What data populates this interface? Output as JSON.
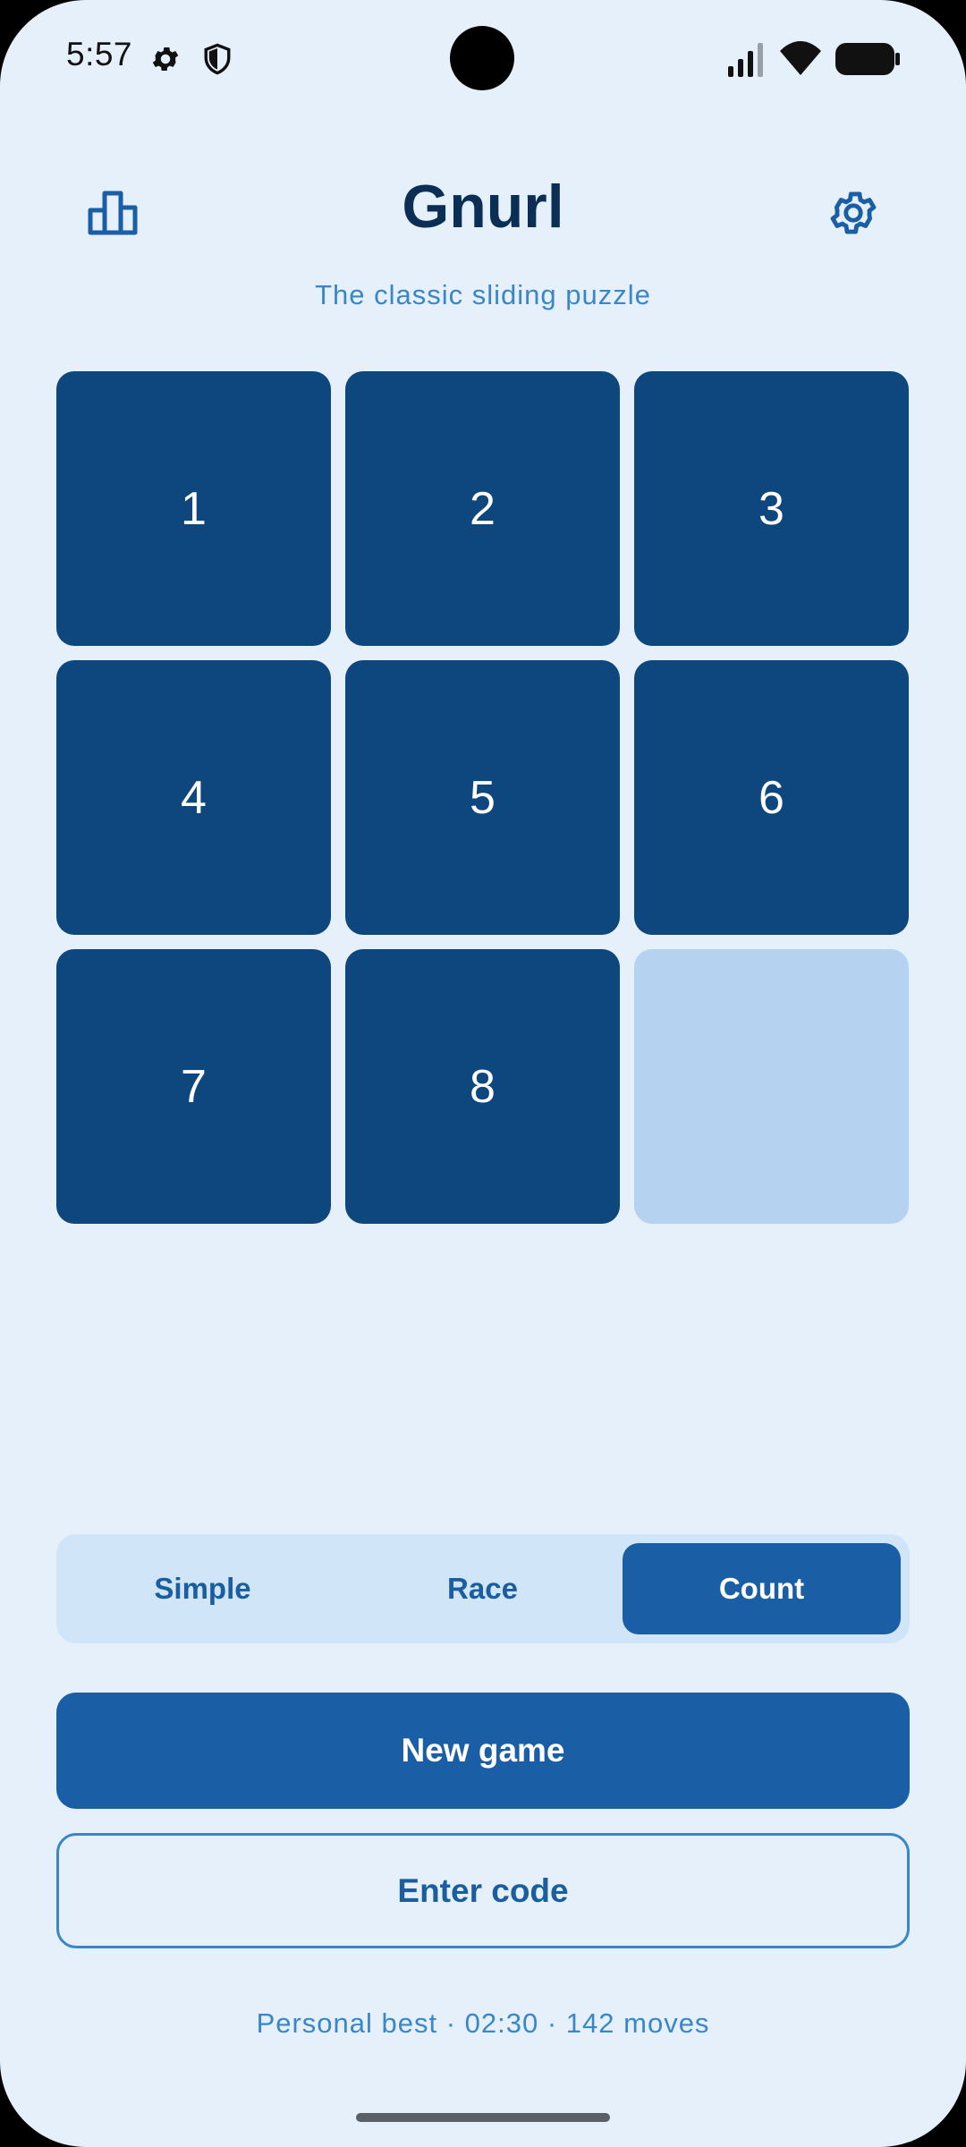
{
  "status_bar": {
    "time": "5:57",
    "icons": [
      "settings-icon",
      "shield-icon",
      "signal-icon",
      "wifi-icon",
      "battery-icon"
    ]
  },
  "header": {
    "title": "Gnurl",
    "subtitle": "The classic sliding puzzle",
    "left_icon": "leaderboard-icon",
    "right_icon": "gear-icon"
  },
  "board": {
    "rows": 3,
    "cols": 3,
    "tiles": [
      "1",
      "2",
      "3",
      "4",
      "5",
      "6",
      "7",
      "8",
      ""
    ]
  },
  "modes": {
    "options": [
      "Simple",
      "Race",
      "Count"
    ],
    "selected": "Count"
  },
  "actions": {
    "new_game": "New game",
    "enter_code": "Enter code"
  },
  "footer": {
    "personal_best": "Personal best · 02:30 · 142 moves"
  },
  "colors": {
    "background": "#e5f0fb",
    "tile": "#0e467e",
    "empty_tile": "#b5d3f1",
    "accent": "#1a5ea5",
    "title": "#0b2e55",
    "muted_text": "#3a86c8"
  }
}
